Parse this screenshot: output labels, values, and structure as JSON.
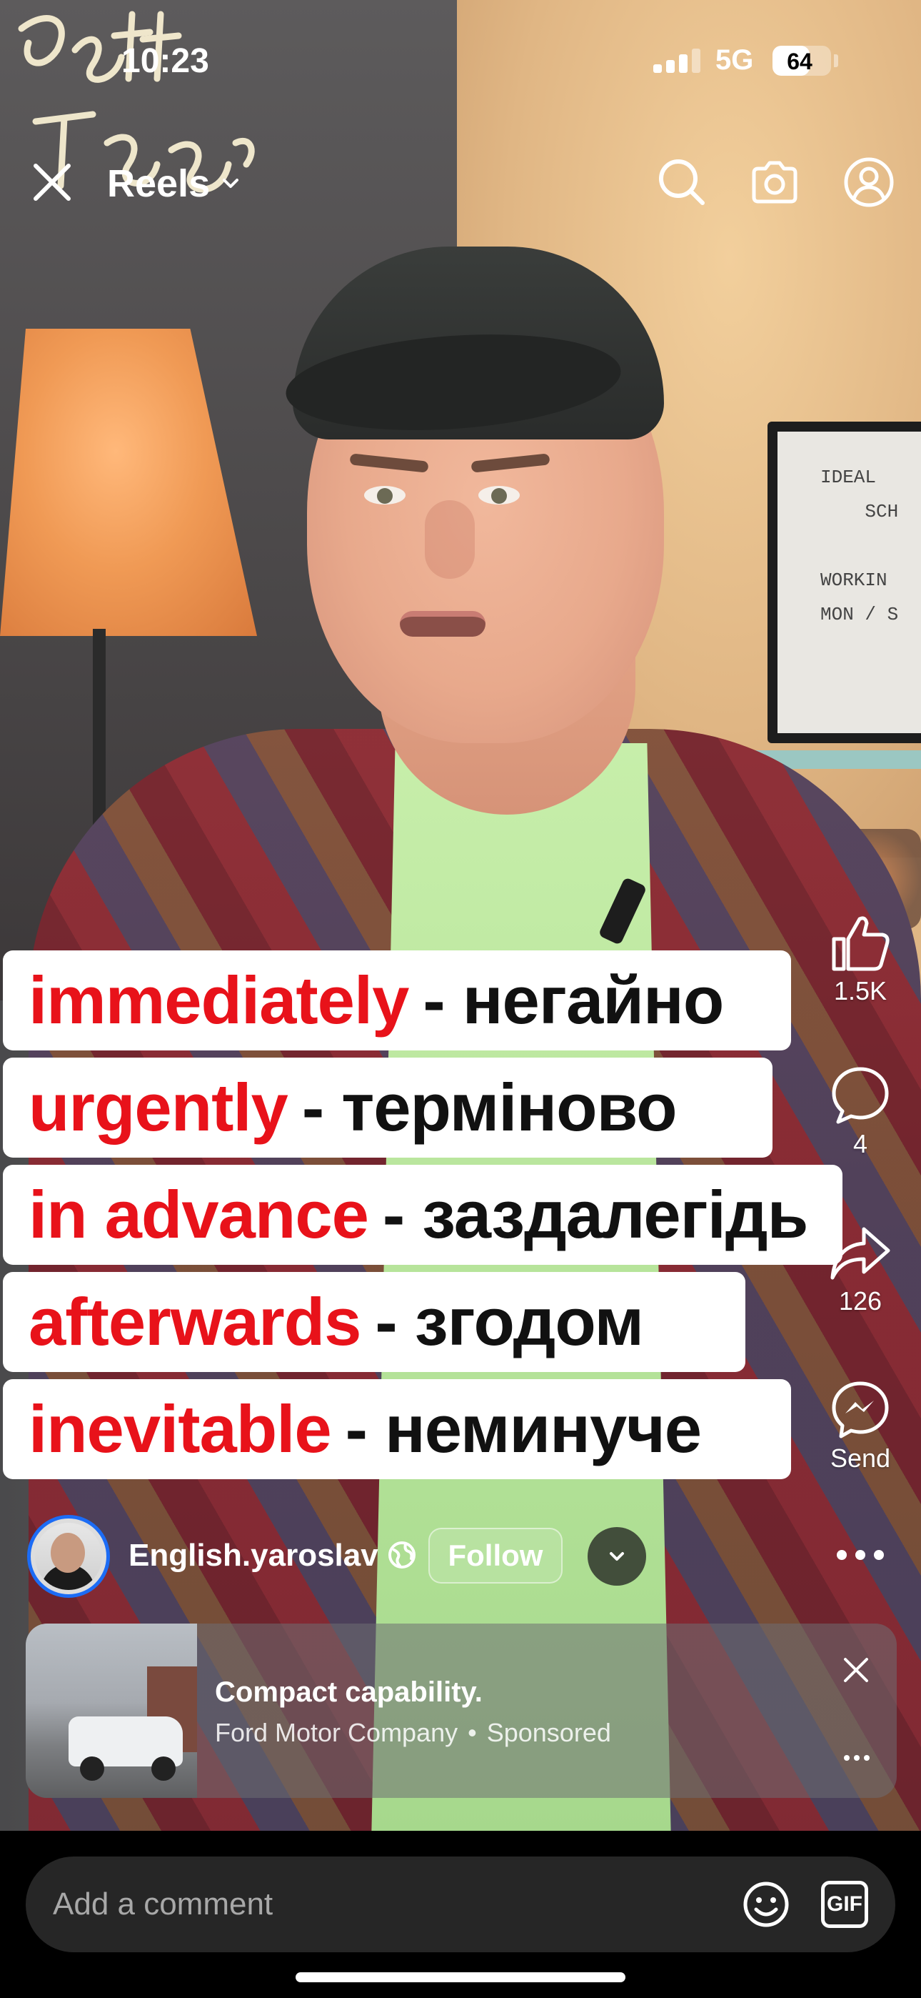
{
  "status_bar": {
    "time": "10:23",
    "network": "5G",
    "battery": "64",
    "battery_level_percent": 64
  },
  "nav": {
    "title": "Reels"
  },
  "backdrop": {
    "frame_text": "IDEAL\n    SCH\n\nWORKIN\nMON / S"
  },
  "captions": [
    {
      "en": "immediately",
      "ua": "- негайно"
    },
    {
      "en": "urgently",
      "ua": "- терміново"
    },
    {
      "en": "in advance",
      "ua": "- заздалегідь"
    },
    {
      "en": "afterwards",
      "ua": "- згодом"
    },
    {
      "en": "inevitable",
      "ua": "- неминуче"
    }
  ],
  "actions": {
    "likes": "1.5K",
    "comments": "4",
    "shares": "126",
    "send_label": "Send"
  },
  "author": {
    "username": "English.yaroslav",
    "follow_label": "Follow"
  },
  "ad": {
    "title": "Compact capability.",
    "advertiser": "Ford Motor Company",
    "separator": "•",
    "sponsored_label": "Sponsored"
  },
  "comment_bar": {
    "placeholder": "Add a comment",
    "gif_label": "GIF"
  },
  "colors": {
    "caption_accent": "#e8121a",
    "avatar_ring": "#1c6cf5"
  }
}
